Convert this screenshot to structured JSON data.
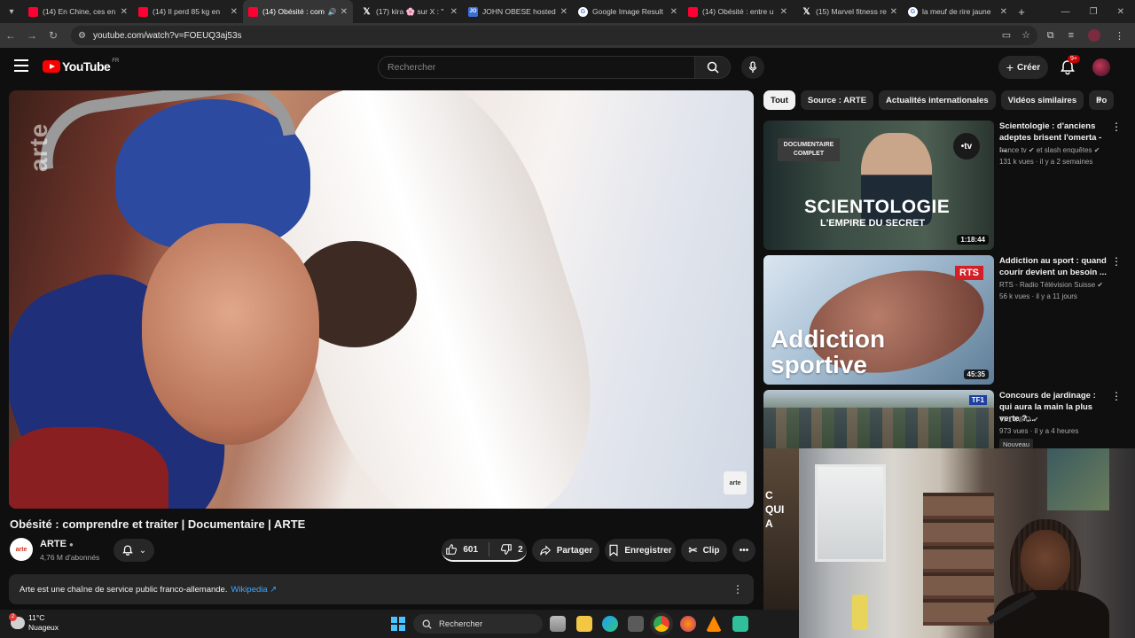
{
  "browser": {
    "tabs": [
      {
        "title": "(14) En Chine, ces en",
        "favicon": "youtube-favicon"
      },
      {
        "title": "(14) Il perd 85 kg en",
        "favicon": "youtube-favicon"
      },
      {
        "title": "(14) Obésité : com",
        "favicon": "youtube-favicon",
        "active": true
      },
      {
        "title": "(17) kira 🌸 sur X : \"",
        "favicon": "x-favicon"
      },
      {
        "title": "JOHN OBESE hosted",
        "favicon": "john-obese-favicon"
      },
      {
        "title": "Google Image Result",
        "favicon": "google-favicon"
      },
      {
        "title": "(14) Obésité : entre u",
        "favicon": "youtube-favicon"
      },
      {
        "title": "(15) Marvel fitness re",
        "favicon": "x-favicon"
      },
      {
        "title": "la meuf de rire jaune",
        "favicon": "google-favicon"
      }
    ],
    "url": "youtube.com/watch?v=FOEUQ3aj53s"
  },
  "youtube": {
    "logo_text": "YouTube",
    "logo_country": "FR",
    "search_placeholder": "Rechercher",
    "create_label": "Créer",
    "notif_count": "9+"
  },
  "video": {
    "title": "Obésité : comprendre et traiter | Documentaire | ARTE",
    "channel": "ARTE",
    "subscribers": "4,76 M d'abonnés",
    "likes": "601",
    "dislikes": "2",
    "share_label": "Partager",
    "save_label": "Enregistrer",
    "clip_label": "Clip",
    "description": "Arte est une chaîne de service public franco-allemande.",
    "description_link": "Wikipedia ↗",
    "watermark": "arte",
    "corner_logo": "arte"
  },
  "chips": [
    "Tout",
    "Source : ARTE",
    "Actualités internationales",
    "Vidéos similaires",
    "Po"
  ],
  "recommendations": [
    {
      "title": "Scientologie : d'anciens adeptes brisent l'omerta - ...",
      "channel": "france tv ✔ et slash enquêtes ✔",
      "meta": "131 k vues · il y a 2 semaines",
      "duration": "1:18:44",
      "thumb_tag": "DOCUMENTAIRE COMPLET",
      "thumb_text": "SCIENTOLOGIE",
      "thumb_sub": "L'EMPIRE DU SECRET",
      "thumb_logo": "•tv"
    },
    {
      "title": "Addiction au sport : quand courir devient un besoin ...",
      "channel": "RTS - Radio Télévision Suisse ✔",
      "meta": "56 k vues · il y a 11 jours",
      "duration": "45:35",
      "thumb_logo": "RTS",
      "thumb_text": "Addiction sportive"
    },
    {
      "title": "Concours de jardinage : qui aura la main la plus verte ?...",
      "channel": "TF1 INFO ✔",
      "meta": "973 vues · il y a 4 heures",
      "badge": "Nouveau",
      "thumb_logo": "TF1"
    }
  ],
  "partial_card_text": "C QUI A",
  "taskbar": {
    "weather_temp": "11°C",
    "weather_desc": "Nuageux",
    "search_label": "Rechercher"
  },
  "colors": {
    "youtube_red": "#ff0000",
    "link_blue": "#3ea6ff",
    "background": "#0f0f0f"
  }
}
